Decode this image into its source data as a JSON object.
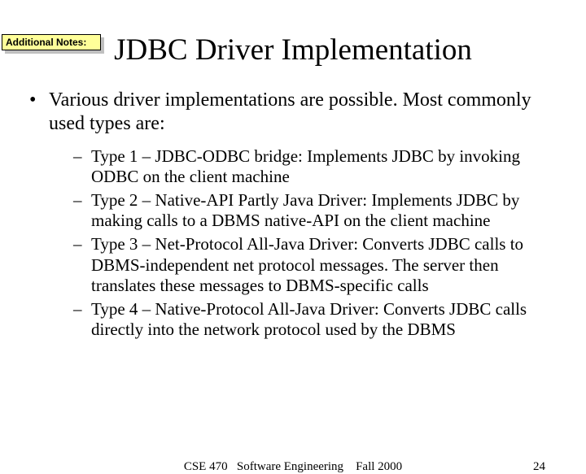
{
  "notes_label": "Additional Notes:",
  "title": "JDBC Driver Implementation",
  "main_bullet": "Various driver implementations are possible.  Most commonly used types are:",
  "subs": [
    "Type 1 – JDBC-ODBC bridge: Implements JDBC by invoking ODBC on the client machine",
    "Type 2 – Native-API Partly Java Driver: Implements JDBC by making calls to a DBMS native-API on the client machine",
    "Type 3 – Net-Protocol All-Java Driver: Converts JDBC calls to DBMS-independent net protocol messages.  The server then translates these messages to DBMS-specific calls",
    "Type 4 – Native-Protocol All-Java Driver: Converts JDBC calls directly into the network protocol used by the DBMS"
  ],
  "footer_course": "CSE 470",
  "footer_title": "Software Engineering",
  "footer_term": "Fall 2000",
  "page_number": "24"
}
